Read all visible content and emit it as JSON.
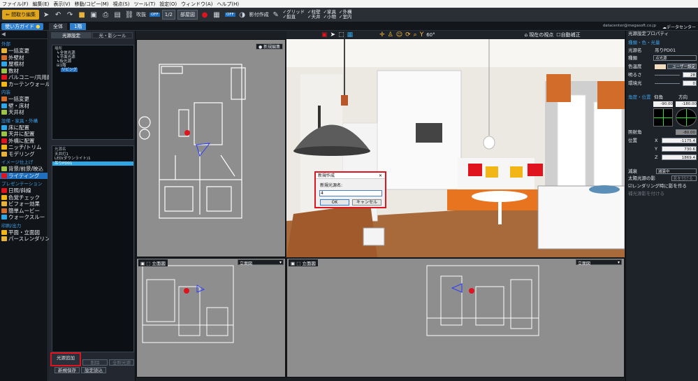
{
  "menu": [
    "ファイル(F)",
    "編集(E)",
    "表示(V)",
    "移動/コピー(M)",
    "視点(S)",
    "ツール(T)",
    "設定(O)",
    "ウィンドウ(A)",
    "ヘルプ(H)"
  ],
  "toolbar": {
    "back_button": "間取り編集",
    "layer_label": "吹抜",
    "off_label": "OFF",
    "page_label": "1/2",
    "view_select": "部屋図",
    "make_shadow": "影付作成",
    "display_label": "OFF",
    "checks": [
      "グリッド",
      "柱壁",
      "家具",
      "外構",
      "鉛直",
      "天井",
      "小物",
      "室内"
    ]
  },
  "bar2": {
    "guide_button": "使い方ガイド",
    "tab_all": "全体",
    "tab_floor": "1階",
    "user_email": "datacenter@megasoft.co.jp",
    "data_center": "データセンター"
  },
  "sidebar": {
    "sections": [
      {
        "title": "外部",
        "items": [
          "一括変更",
          "外壁材",
          "屋根材",
          "数材",
          "バルコニー/共用廊下",
          "カーテンウォール"
        ]
      },
      {
        "title": "内装",
        "items": [
          "一括変更",
          "壁・床材",
          "天井材"
        ]
      },
      {
        "title": "設備・家具・外構",
        "items": [
          "床に配置",
          "天井に配置",
          "外構に配置",
          "ニッチ/トリム",
          "モデリング"
        ]
      },
      {
        "title": "イメージ仕上げ",
        "items": [
          "背景/前景/映込",
          "ライティング"
        ]
      },
      {
        "title": "プレゼンテーション",
        "items": [
          "日照/斜線",
          "色覚チェック",
          "ビフォー効果",
          "簡単ムービー",
          "ウォークスルー"
        ]
      },
      {
        "title": "印刷/出力",
        "items": [
          "平面・立面図",
          "パースレンダリング"
        ]
      }
    ],
    "active": "ライティング"
  },
  "left_panel": {
    "tab1": "光源設定",
    "tab2": "光・影シール",
    "tree_title": "場所",
    "tree_items": [
      "全体光源",
      "平面光源",
      "仮光源",
      "1階",
      "リビング"
    ],
    "list_title": "光源名",
    "list_items": [
      "天井灯1",
      "LED(ダウンライト)1",
      "吊りPD01"
    ],
    "selected_light": "吊りPD01",
    "add_light": "光源追加",
    "delete_light": "削除",
    "copy_light": "全照光源",
    "new_save": "新規保存",
    "load_settings": "設定読込"
  },
  "plan_view": {
    "button": "新規編集"
  },
  "viewport_toolbar": {
    "current_viewpoint": "現在の視点",
    "auto_correct": "自動補正",
    "angle": "60°"
  },
  "elev1": {
    "title": "立面図",
    "select": "立面図"
  },
  "elev2": {
    "title": "立面図",
    "select": "立面図"
  },
  "dialog": {
    "title": "新規作成",
    "label": "新規光源名:",
    "value": "4",
    "ok": "OK",
    "cancel": "キャンセル"
  },
  "right_panel": {
    "header": "光源設定プロパティ",
    "section1": "種類・色・光量",
    "light_name_label": "光源名",
    "light_name": "吊りPD01",
    "kind_label": "種類",
    "kind": "点光源",
    "color_label": "色温度",
    "color_value": "ユーザー設定",
    "brightness_label": "明るさ",
    "brightness": "28",
    "ambient_label": "環境光",
    "ambient": "0",
    "section2": "角度・位置",
    "elev_label": "仰角",
    "dir_label": "方向",
    "elev": "-90.00",
    "dir": "-180.00",
    "spread_label": "照射角",
    "spread": "-80.00",
    "pos_label": "位置",
    "x_label": "X",
    "x": "-1175.4",
    "y_label": "Y",
    "y": "730.6",
    "z_label": "Z",
    "z": "1869.4",
    "decay_label": "減衰",
    "decay": "減衰中",
    "sun_label": "太陽光源の影",
    "sun_value": "影を付ける",
    "render_check": "レンダリング時に影を作る",
    "sub_check": "補光源影を付ける"
  },
  "colors": {
    "accent": "#1f6fbf",
    "highlight": "#e0141e",
    "bg": "#1b1f24"
  }
}
